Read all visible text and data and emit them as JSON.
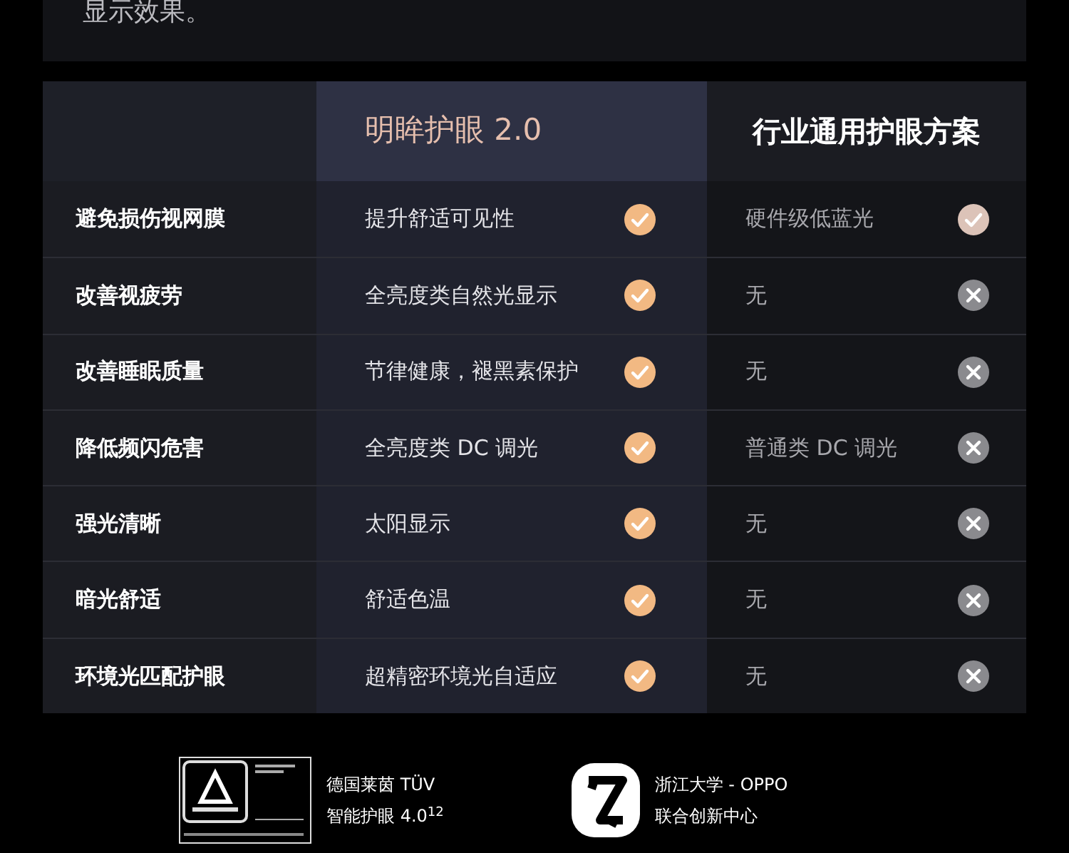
{
  "intro": {
    "text": "显示效果。"
  },
  "table": {
    "columns": [
      "明眸护眼 2.0",
      "行业通用护眼方案"
    ],
    "rows": [
      {
        "feature": "避免损伤视网膜",
        "ours": {
          "text": "提升舒适可见性",
          "kind": "check"
        },
        "theirs": {
          "text": "硬件级低蓝光",
          "kind": "pale"
        }
      },
      {
        "feature": "改善视疲劳",
        "ours": {
          "text": "全亮度类自然光显示",
          "kind": "check"
        },
        "theirs": {
          "text": "无",
          "kind": "cross"
        }
      },
      {
        "feature": "改善睡眠质量",
        "ours": {
          "text": "节律健康，褪黑素保护",
          "kind": "check"
        },
        "theirs": {
          "text": "无",
          "kind": "cross"
        }
      },
      {
        "feature": "降低频闪危害",
        "ours": {
          "text": "全亮度类 DC 调光",
          "kind": "check"
        },
        "theirs": {
          "text": "普通类 DC 调光",
          "kind": "cross"
        }
      },
      {
        "feature": "强光清晰",
        "ours": {
          "text": "太阳显示",
          "kind": "check"
        },
        "theirs": {
          "text": "无",
          "kind": "cross"
        }
      },
      {
        "feature": "暗光舒适",
        "ours": {
          "text": "舒适色温",
          "kind": "check"
        },
        "theirs": {
          "text": "无",
          "kind": "cross"
        }
      },
      {
        "feature": "环境光匹配护眼",
        "ours": {
          "text": "超精密环境光自适应",
          "kind": "check"
        },
        "theirs": {
          "text": "无",
          "kind": "cross"
        }
      }
    ]
  },
  "certifications": [
    {
      "kind": "tuv",
      "lines": [
        "德国莱茵 TÜV",
        "智能护眼 4.0$^{12}$"
      ]
    },
    {
      "kind": "zju",
      "lines": [
        "浙江大学 - OPPO",
        "联合创新中心"
      ]
    }
  ]
}
